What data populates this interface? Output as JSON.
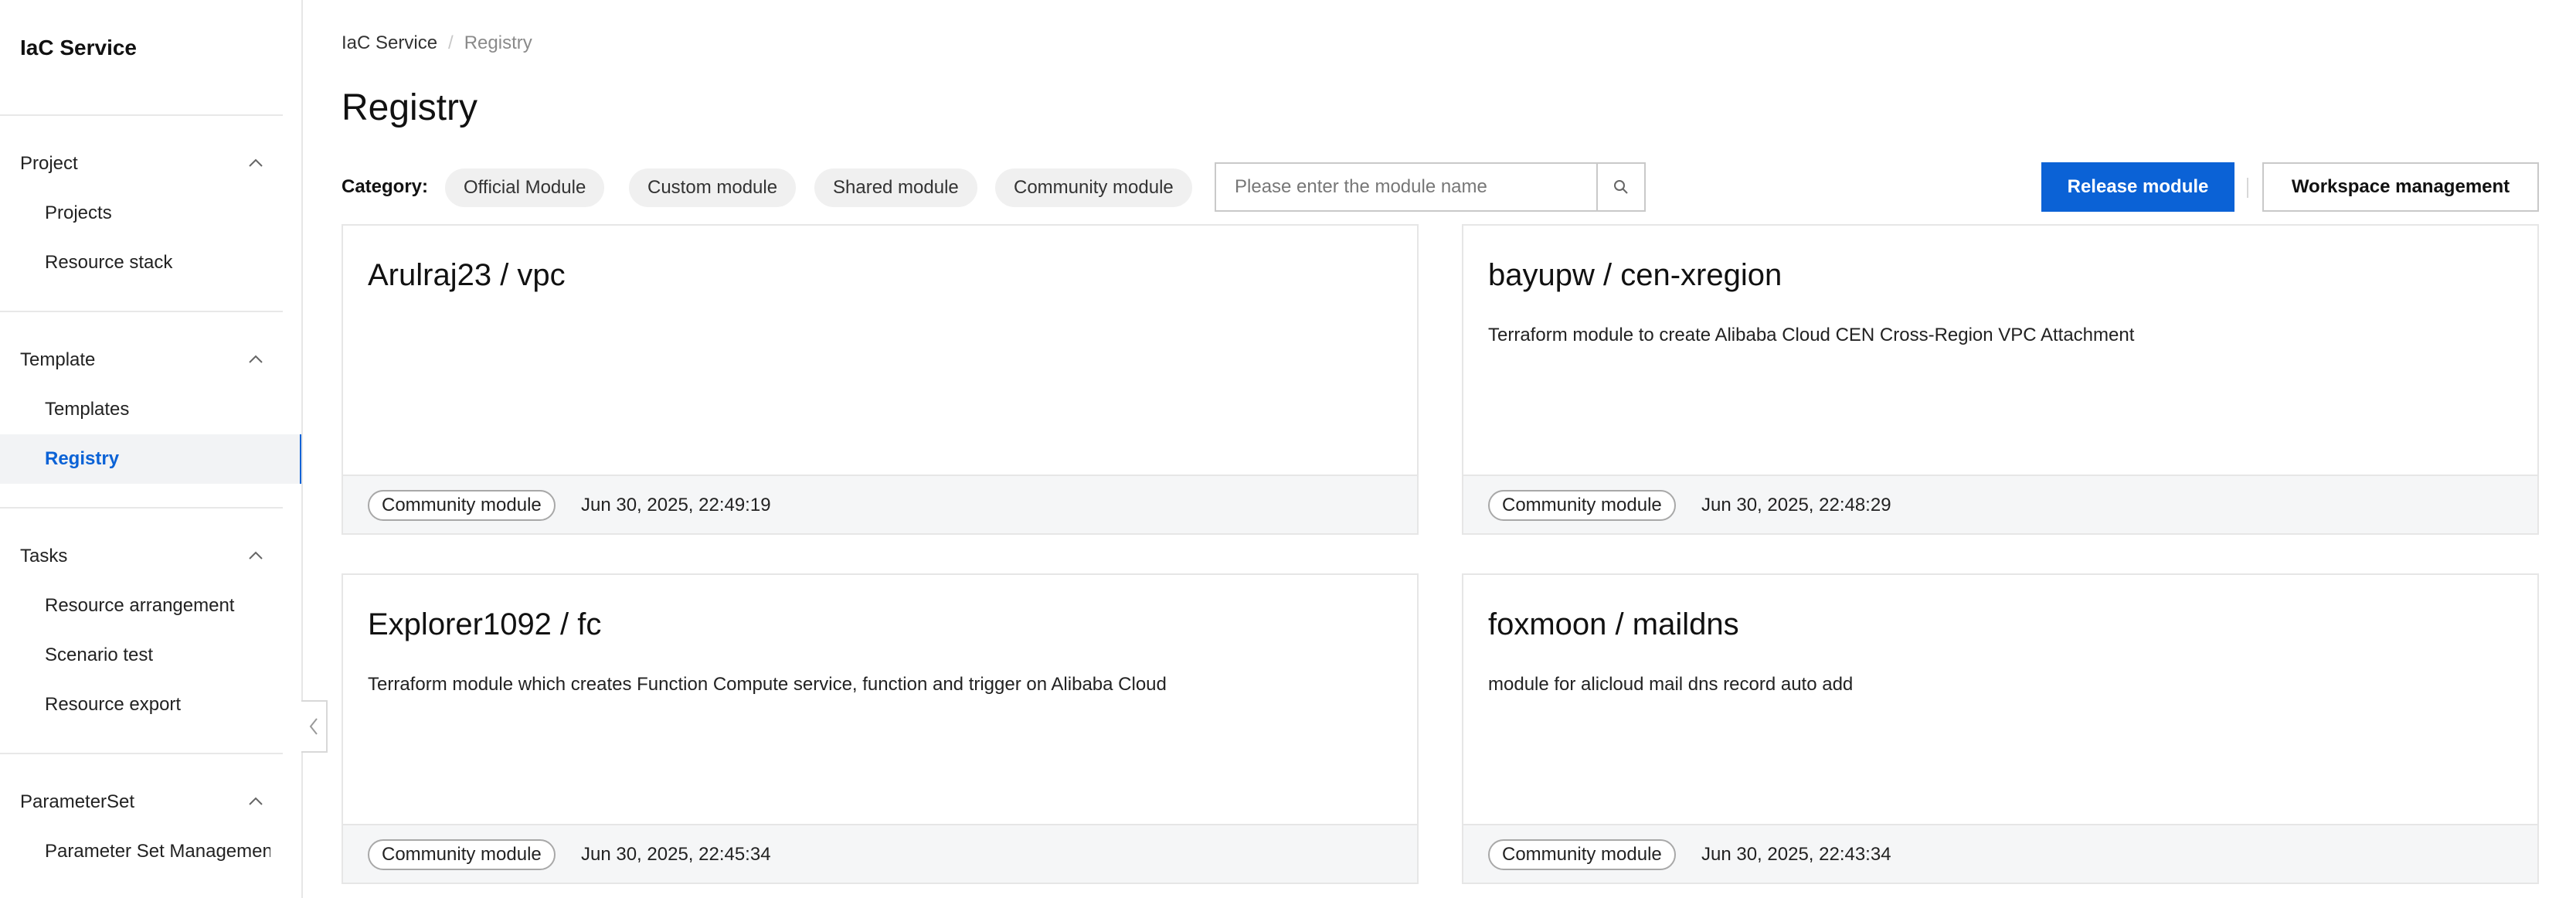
{
  "sidebar": {
    "brand": "IaC Service",
    "groups": [
      {
        "title": "Project",
        "items": [
          "Projects",
          "Resource stack"
        ]
      },
      {
        "title": "Template",
        "items": [
          "Templates",
          "Registry"
        ]
      },
      {
        "title": "Tasks",
        "items": [
          "Resource arrangement",
          "Scenario test",
          "Resource export"
        ]
      },
      {
        "title": "ParameterSet",
        "items": [
          "Parameter Set Management"
        ]
      }
    ],
    "active_item": "Registry"
  },
  "breadcrumb": {
    "root": "IaC Service",
    "separator": "/",
    "current": "Registry"
  },
  "page": {
    "title": "Registry"
  },
  "toolbar": {
    "category_label": "Category:",
    "categories": [
      "Official Module",
      "Custom module",
      "Shared module",
      "Community module"
    ],
    "search_placeholder": "Please enter the module name",
    "release_label": "Release module",
    "workspace_label": "Workspace management"
  },
  "cards": [
    {
      "title": "Arulraj23 / vpc",
      "description": "",
      "tag": "Community module",
      "time": "Jun 30, 2025, 22:49:19"
    },
    {
      "title": "bayupw / cen-xregion",
      "description": "Terraform module to create Alibaba Cloud CEN Cross-Region VPC Attachment",
      "tag": "Community module",
      "time": "Jun 30, 2025, 22:48:29"
    },
    {
      "title": "Explorer1092 / fc",
      "description": "Terraform module which creates Function Compute service, function and trigger on Alibaba Cloud",
      "tag": "Community module",
      "time": "Jun 30, 2025, 22:45:34"
    },
    {
      "title": "foxmoon / maildns",
      "description": "module for alicloud mail dns record auto add",
      "tag": "Community module",
      "time": "Jun 30, 2025, 22:43:34"
    }
  ],
  "colors": {
    "accent": "#0b62d6",
    "active_bg": "#f2f3f5"
  }
}
